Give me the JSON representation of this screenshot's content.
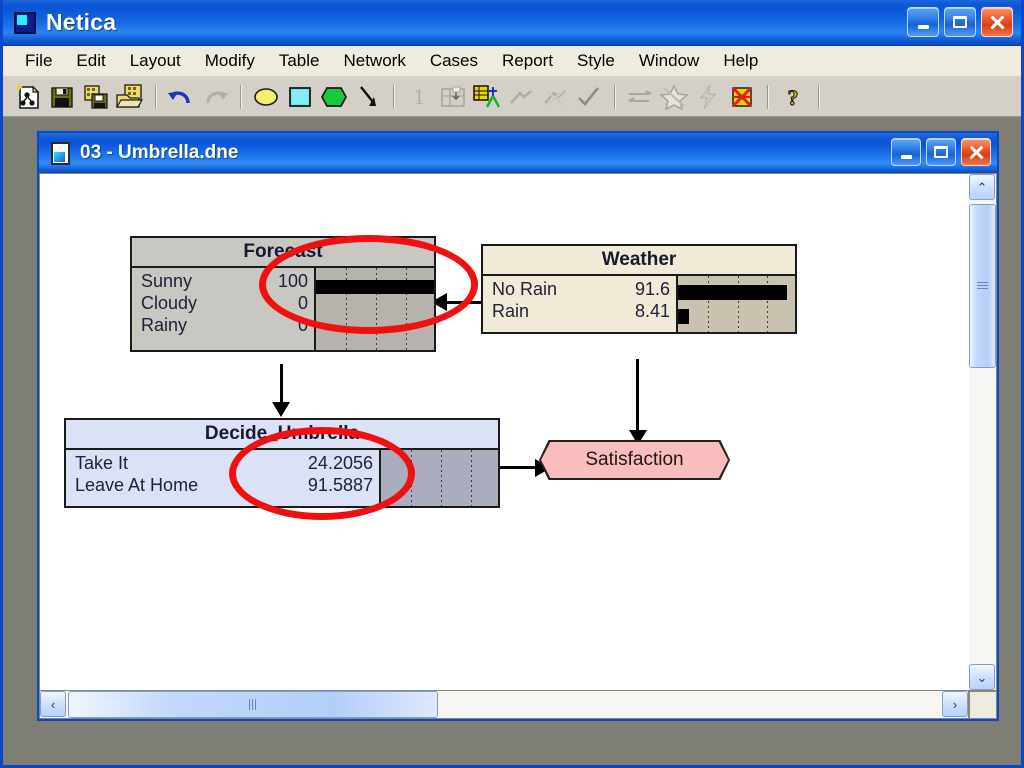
{
  "app": {
    "title": "Netica",
    "icon": "netica-app-icon",
    "window_controls": [
      {
        "name": "minimize",
        "glyph": "_"
      },
      {
        "name": "maximize",
        "glyph": "□"
      },
      {
        "name": "close",
        "glyph": "×"
      }
    ]
  },
  "menubar": {
    "items": [
      {
        "label": "File"
      },
      {
        "label": "Edit"
      },
      {
        "label": "Layout"
      },
      {
        "label": "Modify"
      },
      {
        "label": "Table"
      },
      {
        "label": "Network"
      },
      {
        "label": "Cases"
      },
      {
        "label": "Report"
      },
      {
        "label": "Style"
      },
      {
        "label": "Window"
      },
      {
        "label": "Help"
      }
    ]
  },
  "toolbar": {
    "buttons": [
      {
        "name": "new-network-icon",
        "enabled": true
      },
      {
        "name": "save-icon",
        "enabled": true
      },
      {
        "name": "save-as-icon",
        "enabled": true
      },
      {
        "name": "open-icon",
        "enabled": true
      },
      {
        "name": "separator-1",
        "separator": true
      },
      {
        "name": "undo-icon",
        "enabled": true
      },
      {
        "name": "redo-icon",
        "enabled": false
      },
      {
        "name": "separator-2",
        "separator": true
      },
      {
        "name": "nature-node-icon",
        "enabled": true
      },
      {
        "name": "decision-node-icon",
        "enabled": true
      },
      {
        "name": "utility-node-icon",
        "enabled": true
      },
      {
        "name": "link-arrow-icon",
        "enabled": true
      },
      {
        "name": "separator-3",
        "separator": true
      },
      {
        "name": "one-icon",
        "label": "1",
        "enabled": false
      },
      {
        "name": "table-enter-icon",
        "enabled": false
      },
      {
        "name": "equation-to-table-icon",
        "enabled": true
      },
      {
        "name": "learn-icon",
        "enabled": false
      },
      {
        "name": "unlearn-icon",
        "enabled": false
      },
      {
        "name": "check-icon",
        "enabled": true
      },
      {
        "name": "separator-4",
        "separator": true
      },
      {
        "name": "reverse-link-icon",
        "enabled": false
      },
      {
        "name": "absorb-node-icon",
        "enabled": false
      },
      {
        "name": "compile-icon",
        "enabled": false
      },
      {
        "name": "uncompile-icon",
        "enabled": true
      },
      {
        "name": "separator-5",
        "separator": true
      },
      {
        "name": "help-question-icon",
        "enabled": true
      },
      {
        "name": "separator-6",
        "separator": true
      }
    ]
  },
  "document": {
    "title": "03 - Umbrella.dne",
    "icon": "document-icon",
    "window_controls": [
      {
        "name": "minimize",
        "glyph": "_"
      },
      {
        "name": "maximize",
        "glyph": "□"
      },
      {
        "name": "close",
        "glyph": "×"
      }
    ]
  },
  "network": {
    "nodes": [
      {
        "id": "forecast",
        "kind": "nature",
        "title": "Forecast",
        "states": [
          {
            "label": "Sunny",
            "value": "100",
            "bar_pct": 100
          },
          {
            "label": "Cloudy",
            "value": "0",
            "bar_pct": 0
          },
          {
            "label": "Rainy",
            "value": "0",
            "bar_pct": 0
          }
        ]
      },
      {
        "id": "weather",
        "kind": "nature",
        "title": "Weather",
        "states": [
          {
            "label": "No Rain",
            "value": "91.6",
            "bar_pct": 91.6
          },
          {
            "label": "Rain",
            "value": "8.41",
            "bar_pct": 8.41
          }
        ]
      },
      {
        "id": "decide_umbrella",
        "kind": "decision",
        "title": "Decide_Umbrella",
        "states": [
          {
            "label": "Take It",
            "value": "24.2056",
            "bar_pct": 0
          },
          {
            "label": "Leave At Home",
            "value": "91.5887",
            "bar_pct": 0
          }
        ]
      },
      {
        "id": "satisfaction",
        "kind": "utility",
        "title": "Satisfaction",
        "states": []
      }
    ],
    "links": [
      {
        "from": "weather",
        "to": "forecast",
        "direction": "left"
      },
      {
        "from": "forecast",
        "to": "decide_umbrella",
        "direction": "down"
      },
      {
        "from": "weather",
        "to": "satisfaction",
        "direction": "down"
      },
      {
        "from": "decide_umbrella",
        "to": "satisfaction",
        "direction": "right"
      }
    ],
    "annotations": [
      {
        "name": "highlight-forecast-sunny",
        "shape": "ellipse",
        "color": "#ef1111"
      },
      {
        "name": "highlight-decision-utilities",
        "shape": "ellipse",
        "color": "#ef1111"
      }
    ]
  },
  "scrollbars": {
    "vertical": {
      "up_glyph": "⌃",
      "down_glyph": "⌄"
    },
    "horizontal": {
      "left_glyph": "‹",
      "right_glyph": "›"
    }
  },
  "colors": {
    "title_blue": "#0b54d6",
    "menu_bg": "#efebde",
    "toolbar_bg": "#d4d0c8",
    "canvas_bg": "#ffffff",
    "nature_node": "#c9c7c2",
    "weather_node": "#f0ead6",
    "decision_node": "#dbe2f5",
    "utility_node": "#f7b9b9",
    "annotation_red": "#ef1111"
  }
}
